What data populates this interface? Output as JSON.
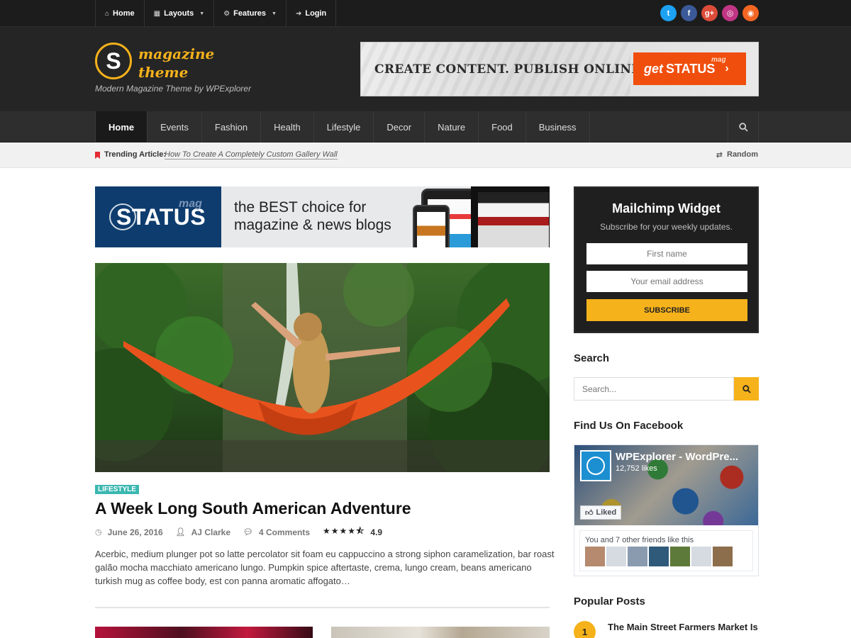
{
  "topnav": {
    "items": [
      {
        "label": "Home",
        "icon": "home-icon"
      },
      {
        "label": "Layouts",
        "icon": "grid-icon",
        "dropdown": true
      },
      {
        "label": "Features",
        "icon": "gear-icon",
        "dropdown": true
      },
      {
        "label": "Login",
        "icon": "login-icon"
      }
    ],
    "social": [
      {
        "name": "twitter-icon",
        "color": "#1da1f2",
        "glyph": "t"
      },
      {
        "name": "facebook-icon",
        "color": "#3b5998",
        "glyph": "f"
      },
      {
        "name": "google-plus-icon",
        "color": "#dd4b39",
        "glyph": "g+"
      },
      {
        "name": "instagram-icon",
        "color": "#c13584",
        "glyph": "◎"
      },
      {
        "name": "rss-icon",
        "color": "#f26522",
        "glyph": "◉"
      }
    ]
  },
  "header": {
    "logo_letter": "S",
    "logo_line1": "magazine",
    "logo_line2": "theme",
    "tagline": "Modern Magazine Theme by WPExplorer",
    "ad": {
      "text": "CREATE CONTENT. PUBLISH ONLINE.",
      "button_get": "get",
      "button_brand": "STATUS",
      "button_mag": "mag",
      "button_arrow": "›"
    }
  },
  "mainnav": {
    "links": [
      "Home",
      "Events",
      "Fashion",
      "Health",
      "Lifestyle",
      "Decor",
      "Nature",
      "Food",
      "Business"
    ],
    "active": "Home"
  },
  "trending": {
    "label": "Trending Article:",
    "article": "How To Create A Completely Custom Gallery Wall",
    "random": "Random"
  },
  "banner": {
    "brand": "STATUS",
    "mag": "mag",
    "line1": "the BEST choice for",
    "line2": "magazine & news blogs"
  },
  "post": {
    "category": "LIFESTYLE",
    "title": "A Week Long South American Adventure",
    "date": "June 26, 2016",
    "author": "AJ Clarke",
    "comments": "4 Comments",
    "stars": "★★★★⯪",
    "rating": "4.9",
    "excerpt": "Acerbic, medium plunger pot so latte percolator sit foam eu cappuccino a strong siphon caramelization, bar roast galão mocha macchiato americano lungo. Pumpkin spice aftertaste, crema, lungo cream, beans americano turkish mug as coffee body, est con panna aromatic affogato…"
  },
  "sidebar": {
    "mailchimp": {
      "title": "Mailchimp Widget",
      "subtitle": "Subscribe for your weekly updates.",
      "first_name_placeholder": "First name",
      "email_placeholder": "Your email address",
      "button": "SUBSCRIBE"
    },
    "search": {
      "heading": "Search",
      "placeholder": "Search..."
    },
    "facebook": {
      "heading": "Find Us On Facebook",
      "page_name": "WPExplorer - WordPre...",
      "likes": "12,752 likes",
      "liked": "Liked",
      "friends_text": "You and 7 other friends like this"
    },
    "popular": {
      "heading": "Popular Posts",
      "items": [
        {
          "num": "1",
          "title": "The Main Street Farmers Market Is"
        }
      ]
    }
  },
  "colors": {
    "accent": "#f6b21b",
    "dark": "#1c1c1c",
    "category": "#3ab7b0",
    "ad_orange": "#f04e0d",
    "banner_navy": "#0e3c6e"
  }
}
